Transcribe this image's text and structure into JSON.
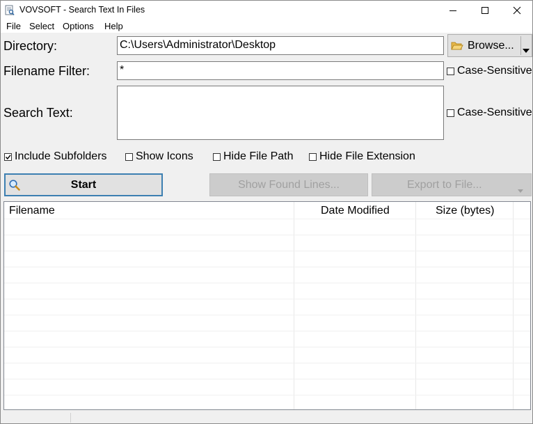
{
  "window": {
    "title": "VOVSOFT - Search Text In Files"
  },
  "menu": [
    "File",
    "Select",
    "Options",
    "Help"
  ],
  "form": {
    "directory_label": "Directory:",
    "directory_value": "C:\\Users\\Administrator\\Desktop",
    "browse_label": "Browse...",
    "filter_label": "Filename Filter:",
    "filter_value": "*",
    "search_label": "Search Text:",
    "search_value": "",
    "case_sensitive_filter": "Case-Sensitive",
    "case_sensitive_search": "Case-Sensitive"
  },
  "options": {
    "include_subfolders": {
      "label": "Include Subfolders",
      "checked": true
    },
    "show_icons": {
      "label": "Show Icons",
      "checked": false
    },
    "hide_file_path": {
      "label": "Hide File Path",
      "checked": false
    },
    "hide_file_extension": {
      "label": "Hide File Extension",
      "checked": false
    }
  },
  "actions": {
    "start": "Start",
    "show_found_lines": "Show Found Lines...",
    "export": "Export to File..."
  },
  "results": {
    "columns": [
      "Filename",
      "Date Modified",
      "Size (bytes)"
    ],
    "rows": []
  },
  "colors": {
    "focus_border": "#3c7fb1",
    "disabled_text": "#a0a0a0",
    "disabled_bg": "#cccccc"
  }
}
